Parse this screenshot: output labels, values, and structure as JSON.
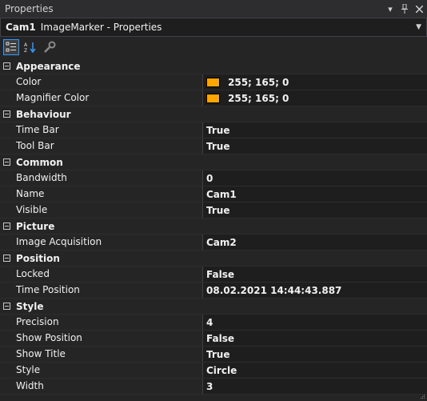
{
  "window": {
    "title": "Properties"
  },
  "selector": {
    "object_name": "Cam1",
    "object_type": "ImageMarker - Properties"
  },
  "colors": {
    "accent": "#3399ff",
    "swatch": "#ffa500",
    "background": "#252526",
    "value_background": "#1e1e1e"
  },
  "categories": [
    {
      "label": "Appearance",
      "props": [
        {
          "name": "Color",
          "value": "255; 165; 0",
          "swatch": "#ffa500"
        },
        {
          "name": "Magnifier Color",
          "value": "255; 165; 0",
          "swatch": "#ffa500"
        }
      ]
    },
    {
      "label": "Behaviour",
      "props": [
        {
          "name": "Time Bar",
          "value": "True"
        },
        {
          "name": "Tool Bar",
          "value": "True"
        }
      ]
    },
    {
      "label": "Common",
      "props": [
        {
          "name": "Bandwidth",
          "value": "0"
        },
        {
          "name": "Name",
          "value": "Cam1"
        },
        {
          "name": "Visible",
          "value": "True"
        }
      ]
    },
    {
      "label": "Picture",
      "props": [
        {
          "name": "Image Acquisition",
          "value": "Cam2"
        }
      ]
    },
    {
      "label": "Position",
      "props": [
        {
          "name": "Locked",
          "value": "False"
        },
        {
          "name": "Time Position",
          "value": "08.02.2021 14:44:43.887"
        }
      ]
    },
    {
      "label": "Style",
      "props": [
        {
          "name": "Precision",
          "value": "4"
        },
        {
          "name": "Show Position",
          "value": "False"
        },
        {
          "name": "Show Title",
          "value": "True"
        },
        {
          "name": "Style",
          "value": "Circle"
        },
        {
          "name": "Width",
          "value": "3"
        }
      ]
    }
  ]
}
